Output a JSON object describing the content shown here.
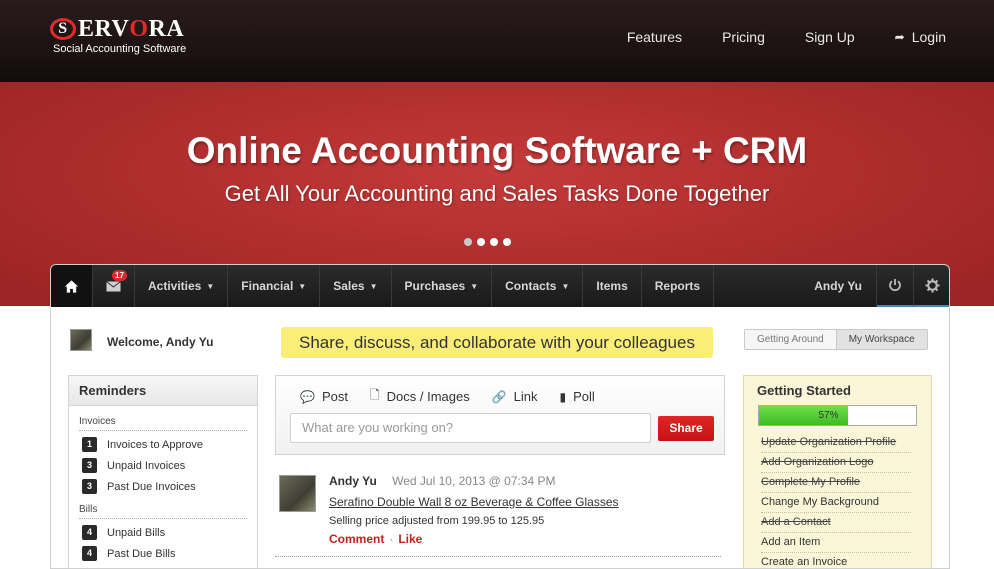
{
  "site": {
    "logo_text_s": "S",
    "logo_text_1": "ERV",
    "logo_text_o": "O",
    "logo_text_2": "RA",
    "tagline": "Social Accounting Software",
    "nav": {
      "features": "Features",
      "pricing": "Pricing",
      "signup": "Sign Up",
      "login": "Login"
    }
  },
  "hero": {
    "title": "Online Accounting Software + CRM",
    "subtitle": "Get All Your Accounting and Sales Tasks Done Together",
    "slide_count": 4,
    "active_slide": 1
  },
  "app": {
    "nav": {
      "mail_badge": "17",
      "activities": "Activities",
      "financial": "Financial",
      "sales": "Sales",
      "purchases": "Purchases",
      "contacts": "Contacts",
      "items": "Items",
      "reports": "Reports",
      "user": "Andy Yu"
    },
    "welcome": "Welcome, Andy Yu",
    "banner": "Share, discuss, and collaborate with your colleagues",
    "toggle": {
      "left": "Getting Around",
      "right": "My Workspace"
    },
    "reminders": {
      "title": "Reminders",
      "invoices_label": "Invoices",
      "invoices": [
        {
          "count": "1",
          "label": "Invoices to Approve"
        },
        {
          "count": "3",
          "label": "Unpaid Invoices"
        },
        {
          "count": "3",
          "label": "Past Due Invoices"
        }
      ],
      "bills_label": "Bills",
      "bills": [
        {
          "count": "4",
          "label": "Unpaid Bills"
        },
        {
          "count": "4",
          "label": "Past Due Bills"
        }
      ]
    },
    "post": {
      "tabs": {
        "post": "Post",
        "docs": "Docs / Images",
        "link": "Link",
        "poll": "Poll"
      },
      "placeholder": "What are you working on?",
      "share": "Share"
    },
    "feed": {
      "author": "Andy Yu",
      "date": "Wed Jul 10, 2013 @ 07:34 PM",
      "product": "Serafino Double Wall 8 oz Beverage & Coffee Glasses",
      "description": "Selling price adjusted from 199.95 to 125.95",
      "comment": "Comment",
      "separator": "·",
      "like": "Like"
    },
    "getting_started": {
      "title": "Getting Started",
      "progress_label": "57%",
      "progress": 0.57,
      "steps": [
        {
          "label": "Update Organization Profile",
          "done": true
        },
        {
          "label": "Add Organization Logo",
          "done": true
        },
        {
          "label": "Complete My Profile",
          "done": true
        },
        {
          "label": "Change My Background",
          "done": false
        },
        {
          "label": "Add a Contact",
          "done": true
        },
        {
          "label": "Add an Item",
          "done": false
        },
        {
          "label": "Create an Invoice",
          "done": false
        }
      ]
    }
  }
}
